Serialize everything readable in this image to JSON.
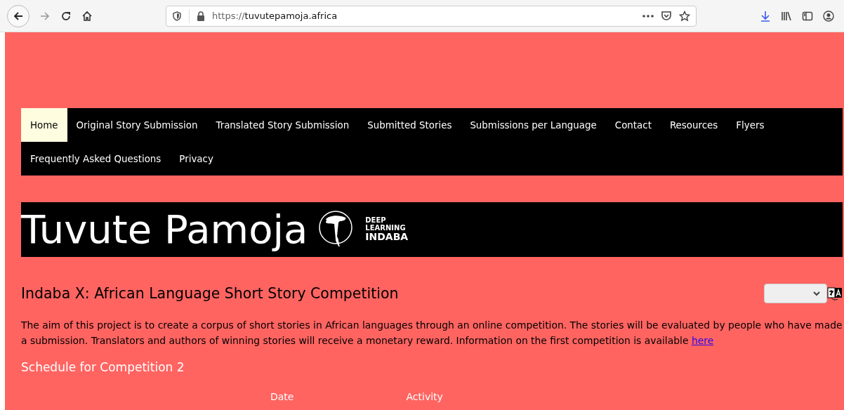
{
  "browser": {
    "url_scheme": "https://",
    "url_host": "tuvutepamoja.africa"
  },
  "nav": [
    {
      "label": "Home",
      "selected": true
    },
    {
      "label": "Original Story Submission",
      "selected": false
    },
    {
      "label": "Translated Story Submission",
      "selected": false
    },
    {
      "label": "Submitted Stories",
      "selected": false
    },
    {
      "label": "Submissions per Language",
      "selected": false
    },
    {
      "label": "Contact",
      "selected": false
    },
    {
      "label": "Resources",
      "selected": false
    },
    {
      "label": "Flyers",
      "selected": false
    },
    {
      "label": "Frequently Asked Questions",
      "selected": false
    },
    {
      "label": "Privacy",
      "selected": false
    }
  ],
  "banner": {
    "title": "Tuvute Pamoja",
    "logo_lines": [
      "DEEP",
      "LEARNING",
      "INDABA"
    ]
  },
  "heading": "Indaba X: African Language Short Story Competition",
  "intro": {
    "text": "The aim of this project is to create a corpus of short stories in African languages through an online competition. The stories will be evaluated by people who have made a submission. Translators and authors of winning stories will receive a monetary reward. Information on the first competition is available",
    "link": "here"
  },
  "schedule": {
    "title": "Schedule for Competition 2",
    "columns": [
      "Date",
      "Activity"
    ]
  }
}
